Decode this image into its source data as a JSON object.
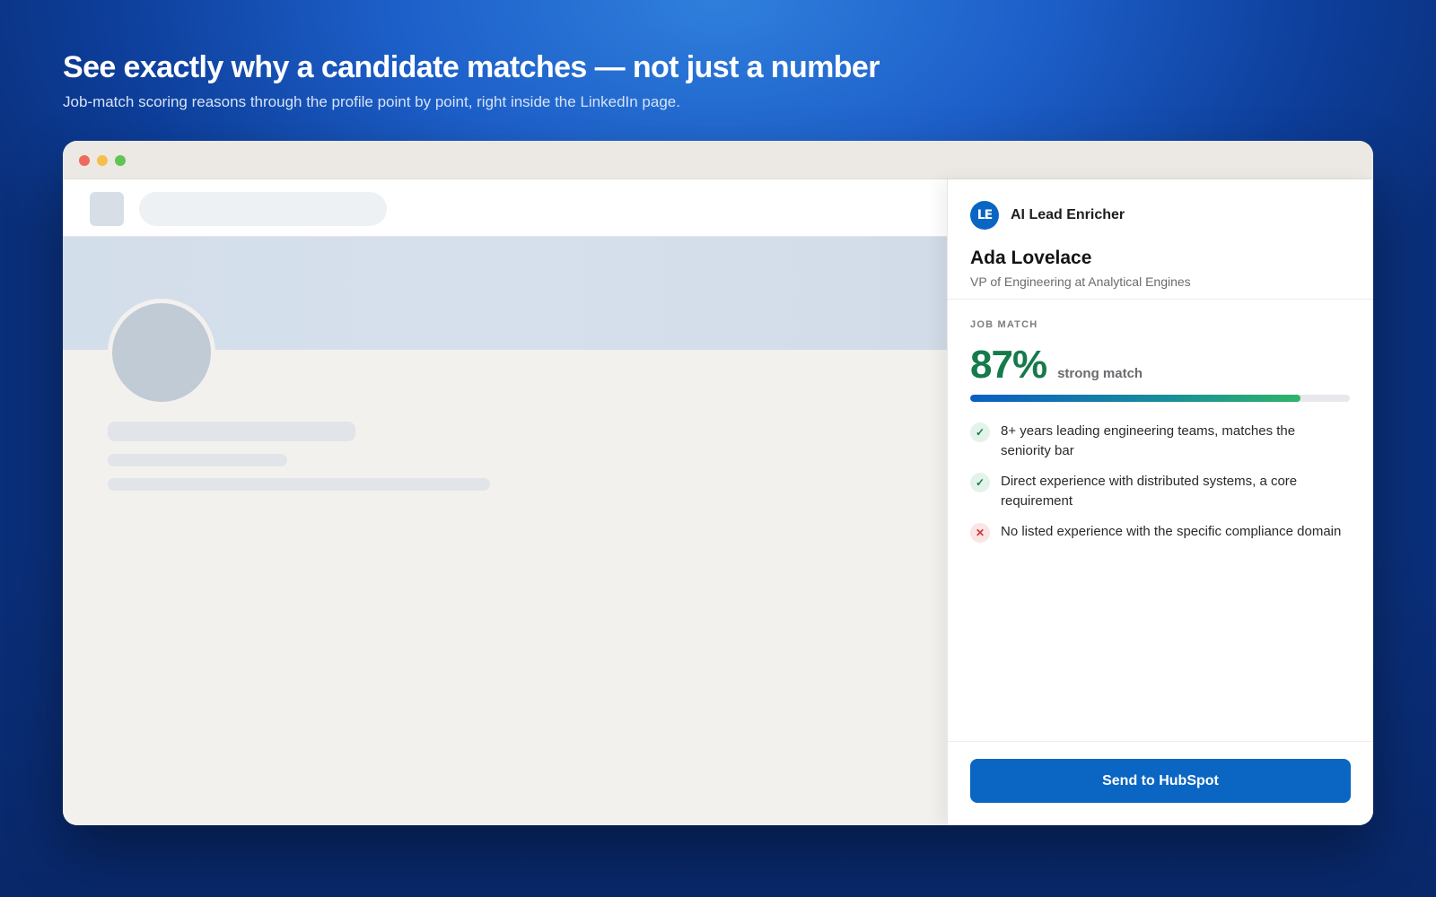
{
  "hero": {
    "headline": "See exactly why a candidate matches — not just a number",
    "subheadline": "Job-match scoring reasons through the profile point by point, right inside the LinkedIn page."
  },
  "panel": {
    "brand": {
      "logo_text": "LE",
      "name": "AI Lead Enricher"
    },
    "person": {
      "name": "Ada Lovelace",
      "title": "VP of Engineering at Analytical Engines"
    },
    "job_match": {
      "label": "JOB MATCH",
      "score": "87%",
      "score_value": 0.87,
      "note": "strong match",
      "reasons": [
        {
          "status": "match",
          "icon": "check-icon",
          "text": "8+ years leading engineering teams, matches the seniority bar"
        },
        {
          "status": "match",
          "icon": "check-icon",
          "text": "Direct experience with distributed systems, a core requirement"
        },
        {
          "status": "miss",
          "icon": "cross-icon",
          "text": "No listed experience with the specific compliance domain"
        }
      ]
    },
    "cta_label": "Send to HubSpot"
  },
  "colors": {
    "accent": "#0a66c2",
    "match_green": "#167a4b",
    "miss_red": "#d0353b"
  }
}
